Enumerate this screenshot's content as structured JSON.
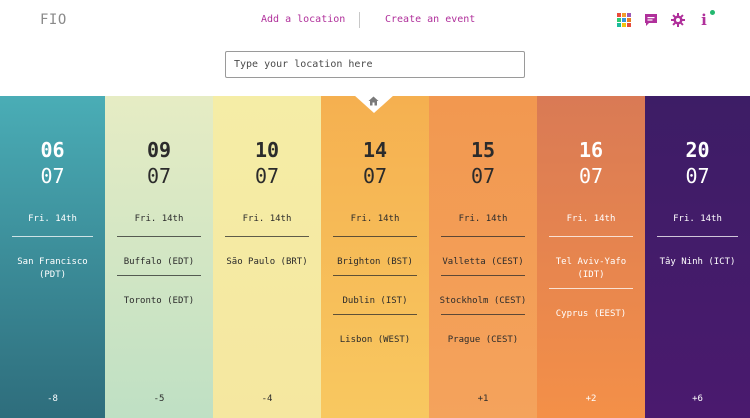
{
  "app": {
    "logo": "FIO"
  },
  "nav": {
    "add_location": "Add a location",
    "create_event": "Create an event"
  },
  "toolbar_icons": [
    "grid-icon",
    "chat-icon",
    "gear-icon",
    "info-icon"
  ],
  "search": {
    "placeholder": "Type your location here",
    "value": ""
  },
  "colors": {
    "accent": "#b0309b",
    "notification": "#23b86f"
  },
  "columns": [
    {
      "day": "06",
      "month": "07",
      "date": "Fri. 14th",
      "cities": [
        "San Francisco (PDT)"
      ],
      "offset": "-8",
      "gradient": [
        "#4aadb6",
        "#2e6d7c"
      ],
      "text": "light"
    },
    {
      "day": "09",
      "month": "07",
      "date": "Fri. 14th",
      "cities": [
        "Buffalo (EDT)",
        "Toronto (EDT)"
      ],
      "offset": "-5",
      "gradient": [
        "#e6ecc4",
        "#bfe0c4"
      ],
      "text": "dark"
    },
    {
      "day": "10",
      "month": "07",
      "date": "Fri. 14th",
      "cities": [
        "São Paulo (BRT)"
      ],
      "offset": "-4",
      "gradient": [
        "#f5eda6",
        "#f5e7a0"
      ],
      "text": "dark"
    },
    {
      "day": "14",
      "month": "07",
      "date": "Fri. 14th",
      "cities": [
        "Brighton (BST)",
        "Dublin (IST)",
        "Lisbon (WEST)"
      ],
      "offset": "",
      "gradient": [
        "#f5b050",
        "#f8c860"
      ],
      "text": "dark"
    },
    {
      "day": "15",
      "month": "07",
      "date": "Fri. 14th",
      "cities": [
        "Valletta (CEST)",
        "Stockholm (CEST)",
        "Prague (CEST)"
      ],
      "offset": "+1",
      "gradient": [
        "#f29850",
        "#f4a35c"
      ],
      "text": "dark"
    },
    {
      "day": "16",
      "month": "07",
      "date": "Fri. 14th",
      "cities": [
        "Tel Aviv-Yafo (IDT)",
        "Cyprus (EEST)"
      ],
      "offset": "+2",
      "gradient": [
        "#d97a55",
        "#f49048"
      ],
      "text": "light"
    },
    {
      "day": "20",
      "month": "07",
      "date": "Fri. 14th",
      "cities": [
        "Tây Ninh (ICT)"
      ],
      "offset": "+6",
      "gradient": [
        "#3d1d66",
        "#4a1a6e"
      ],
      "text": "light"
    }
  ]
}
